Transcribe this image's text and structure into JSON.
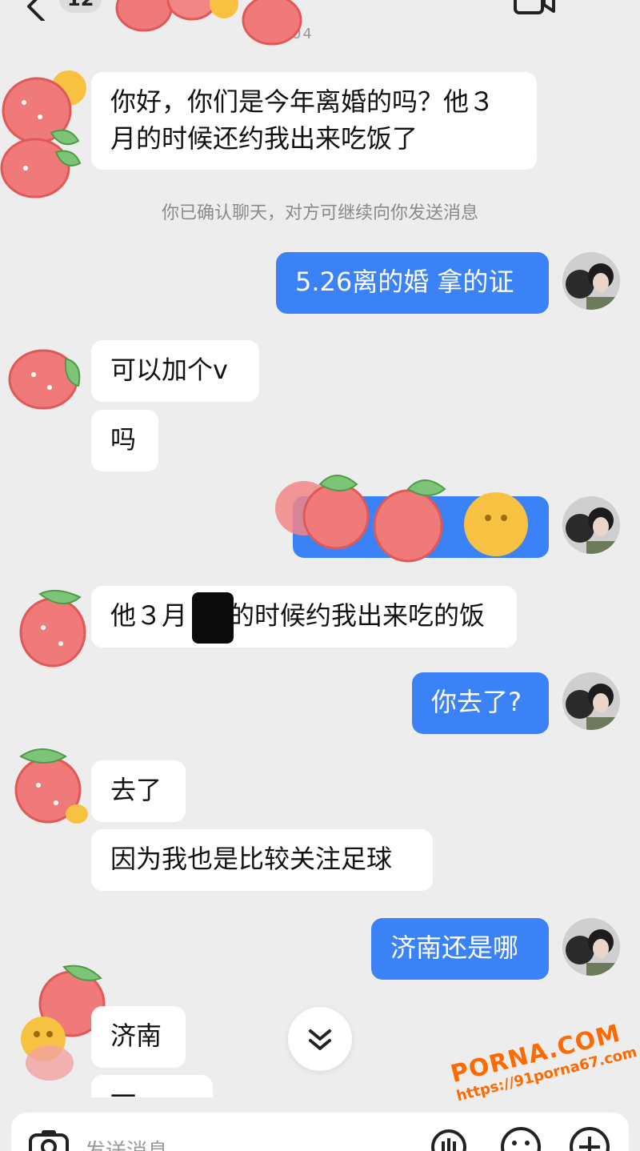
{
  "header": {
    "unread_count": "12",
    "timestamp": "05:04"
  },
  "messages": [
    {
      "side": "recv",
      "text_line1": "你好，你们是今年离婚的吗？他３",
      "text_line2": "月的时候还约我出来吃饭了"
    },
    {
      "side": "notice",
      "text": "你已确认聊天，对方可继续向你发送消息"
    },
    {
      "side": "sent",
      "text": "5.26离的婚 拿的证"
    },
    {
      "side": "recv",
      "text": "可以加个v"
    },
    {
      "side": "recv",
      "text": "吗"
    },
    {
      "side": "sent",
      "text": ""
    },
    {
      "side": "recv",
      "text_pre": "他３月",
      "text_post": "的时候约我出来吃的饭"
    },
    {
      "side": "sent",
      "text": "你去了?"
    },
    {
      "side": "recv",
      "text": "去了"
    },
    {
      "side": "recv",
      "text": "因为我也是比较关注足球"
    },
    {
      "side": "sent",
      "text": "济南还是哪"
    },
    {
      "side": "recv",
      "text": "济南"
    },
    {
      "side": "recv",
      "text": "一"
    }
  ],
  "input": {
    "placeholder": "发送消息"
  },
  "watermark": {
    "logo": "PORNA.COM",
    "url": "https://91porna67.com"
  },
  "colors": {
    "background": "#ededed",
    "sent_bubble": "#3b82f6",
    "recv_bubble": "#ffffff",
    "sticker_red": "#f07a7a",
    "sticker_green": "#7cc576",
    "sticker_yellow": "#f7c242"
  }
}
